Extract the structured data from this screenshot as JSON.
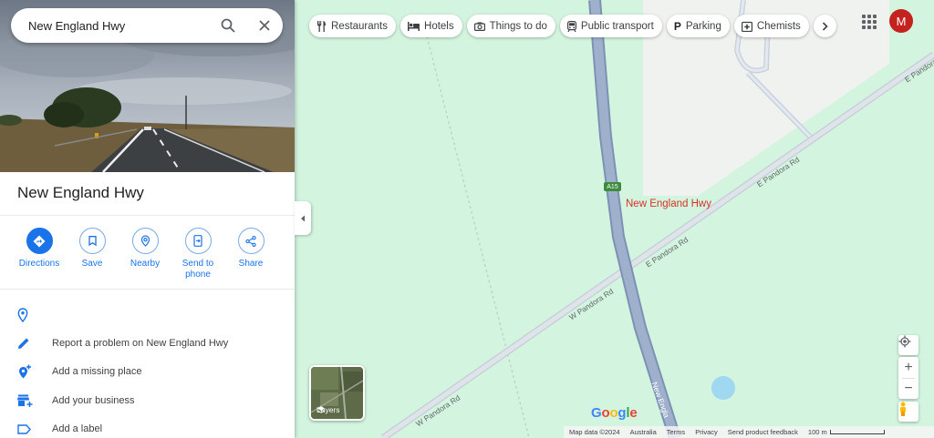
{
  "search": {
    "value": "New England Hwy"
  },
  "place": {
    "title": "New England Hwy"
  },
  "actions": [
    {
      "label": "Directions"
    },
    {
      "label": "Save"
    },
    {
      "label": "Nearby"
    },
    {
      "label": "Send to phone"
    },
    {
      "label": "Share"
    }
  ],
  "info_rows": [
    {
      "label": ""
    },
    {
      "label": "Report a problem on New England Hwy"
    },
    {
      "label": "Add a missing place"
    },
    {
      "label": "Add your business"
    },
    {
      "label": "Add a label"
    }
  ],
  "chips": [
    {
      "label": "Restaurants",
      "icon": "fork-knife-icon"
    },
    {
      "label": "Hotels",
      "icon": "bed-icon"
    },
    {
      "label": "Things to do",
      "icon": "camera-icon"
    },
    {
      "label": "Public transport",
      "icon": "train-icon"
    },
    {
      "label": "Parking",
      "icon": "parking-icon"
    },
    {
      "label": "Chemists",
      "icon": "pharmacy-icon"
    }
  ],
  "user": {
    "avatar_letter": "M",
    "avatar_color": "#c5221f"
  },
  "map": {
    "pin_label": "New England Hwy",
    "road_shield": "A15",
    "road_labels": [
      "E Pandora Rd",
      "E Pandora Rd",
      "E Pandora Rd",
      "W Pandora Rd",
      "W Pandora Rd",
      "New Engla"
    ],
    "layers_label": "Layers",
    "logo": "Google"
  },
  "footer": {
    "map_data": "Map data ©2024",
    "country": "Australia",
    "terms": "Terms",
    "privacy": "Privacy",
    "feedback": "Send product feedback",
    "scale": "100 m"
  },
  "colors": {
    "accent": "#1a73e8",
    "pin": "#d93025",
    "map_bg": "#d3f5df",
    "road": "#8ea4c4"
  }
}
